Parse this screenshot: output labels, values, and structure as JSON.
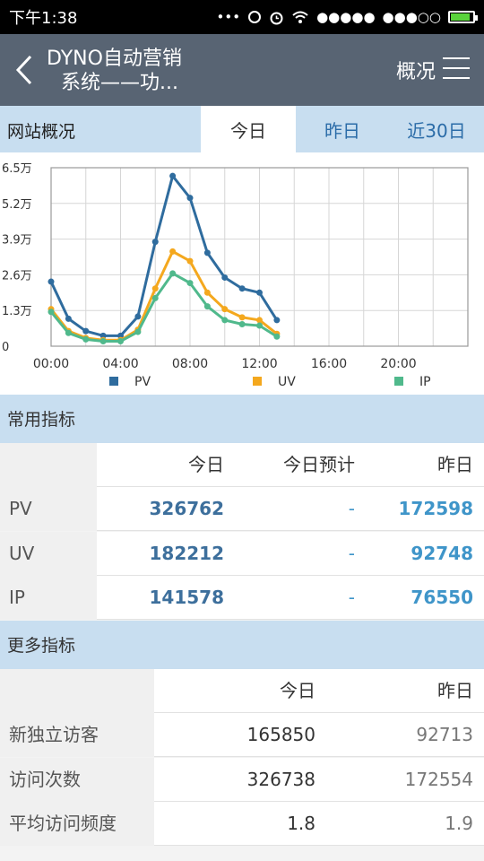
{
  "status_bar": {
    "time": "下午1:38",
    "signal1": "●●●●●",
    "signal2": "●●●○○"
  },
  "header": {
    "title_line1": "DYNO自动营销",
    "title_line2": "系统——功...",
    "page_label": "概况"
  },
  "tabs": {
    "section_title": "网站概况",
    "items": [
      "今日",
      "昨日",
      "近30日"
    ],
    "active": 0
  },
  "chart_data": {
    "type": "line",
    "x": [
      "00:00",
      "01:00",
      "02:00",
      "03:00",
      "04:00",
      "05:00",
      "06:00",
      "07:00",
      "08:00",
      "09:00",
      "10:00",
      "11:00",
      "12:00",
      "13:00"
    ],
    "x_ticks": [
      "00:00",
      "04:00",
      "08:00",
      "12:00",
      "16:00",
      "20:00"
    ],
    "xlim_hours": [
      0,
      24
    ],
    "y_ticks": [
      "6.5万",
      "5.2万",
      "3.9万",
      "2.6万",
      "1.3万",
      "0"
    ],
    "ylim": [
      0,
      65000
    ],
    "grid": true,
    "legend_position": "bottom",
    "series": [
      {
        "name": "PV",
        "color": "#2f6c9e",
        "values": [
          23500,
          10000,
          5500,
          3800,
          3800,
          10800,
          38000,
          62000,
          54000,
          34000,
          25000,
          21000,
          19500,
          9500
        ]
      },
      {
        "name": "UV",
        "color": "#f4a81e",
        "values": [
          13500,
          5500,
          3000,
          2200,
          2200,
          6000,
          21000,
          34500,
          31000,
          19500,
          13500,
          10500,
          9500,
          4500
        ]
      },
      {
        "name": "IP",
        "color": "#50b98c",
        "values": [
          12500,
          4800,
          2500,
          1800,
          1800,
          5200,
          17500,
          26500,
          23000,
          14500,
          9500,
          8000,
          7500,
          3500
        ]
      }
    ]
  },
  "common": {
    "title": "常用指标",
    "headers": [
      "今日",
      "今日预计",
      "昨日"
    ],
    "rows": [
      {
        "label": "PV",
        "today": "326762",
        "forecast": "-",
        "yesterday": "172598"
      },
      {
        "label": "UV",
        "today": "182212",
        "forecast": "-",
        "yesterday": "92748"
      },
      {
        "label": "IP",
        "today": "141578",
        "forecast": "-",
        "yesterday": "76550"
      }
    ]
  },
  "more": {
    "title": "更多指标",
    "headers": [
      "今日",
      "昨日"
    ],
    "rows": [
      {
        "label": "新独立访客",
        "today": "165850",
        "yesterday": "92713"
      },
      {
        "label": "访问次数",
        "today": "326738",
        "yesterday": "172554"
      },
      {
        "label": "平均访问频度",
        "today": "1.8",
        "yesterday": "1.9"
      }
    ]
  },
  "colors": {
    "appbar": "#586473",
    "tab_bar": "#c8def0",
    "accent": "#3f95c9",
    "battery": "#5ad33c"
  }
}
